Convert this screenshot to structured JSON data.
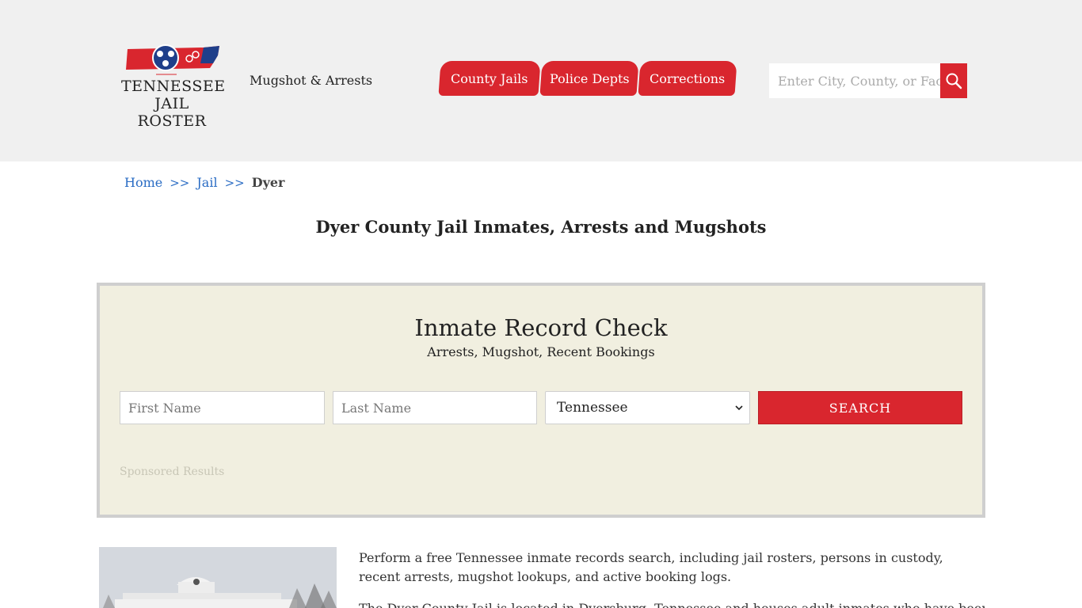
{
  "header": {
    "logo": {
      "line1": "TENNESSEE",
      "line2": "JAIL ROSTER"
    },
    "tagline": "Mugshot & Arrests",
    "nav": [
      {
        "label": "County Jails"
      },
      {
        "label": "Police Depts"
      },
      {
        "label": "Corrections"
      }
    ],
    "search": {
      "placeholder": "Enter City, County, or Facility"
    }
  },
  "breadcrumb": {
    "home": "Home",
    "sep": ">>",
    "jail": "Jail",
    "current": "Dyer"
  },
  "page_title": "Dyer County Jail Inmates, Arrests and Mugshots",
  "record_check": {
    "title": "Inmate Record Check",
    "subtitle": "Arrests, Mugshot, Recent Bookings",
    "first_placeholder": "First Name",
    "last_placeholder": "Last Name",
    "state_selected": "Tennessee",
    "search_label": "SEARCH",
    "sponsored": "Sponsored Results"
  },
  "content": {
    "para1": "Perform a free Tennessee inmate records search, including jail rosters, persons in custody, recent arrests, mugshot lookups, and active booking logs.",
    "para2": "The Dyer County Jail is located in Dyersburg, Tennessee and houses adult inmates who have been"
  },
  "colors": {
    "accent": "#d9262e",
    "panel_bg": "#f1efe0",
    "header_bg": "#f0f0f0",
    "link": "#2a6cc4"
  },
  "icons": {
    "search": "magnifier-icon",
    "select": "chevron-down-icon"
  }
}
